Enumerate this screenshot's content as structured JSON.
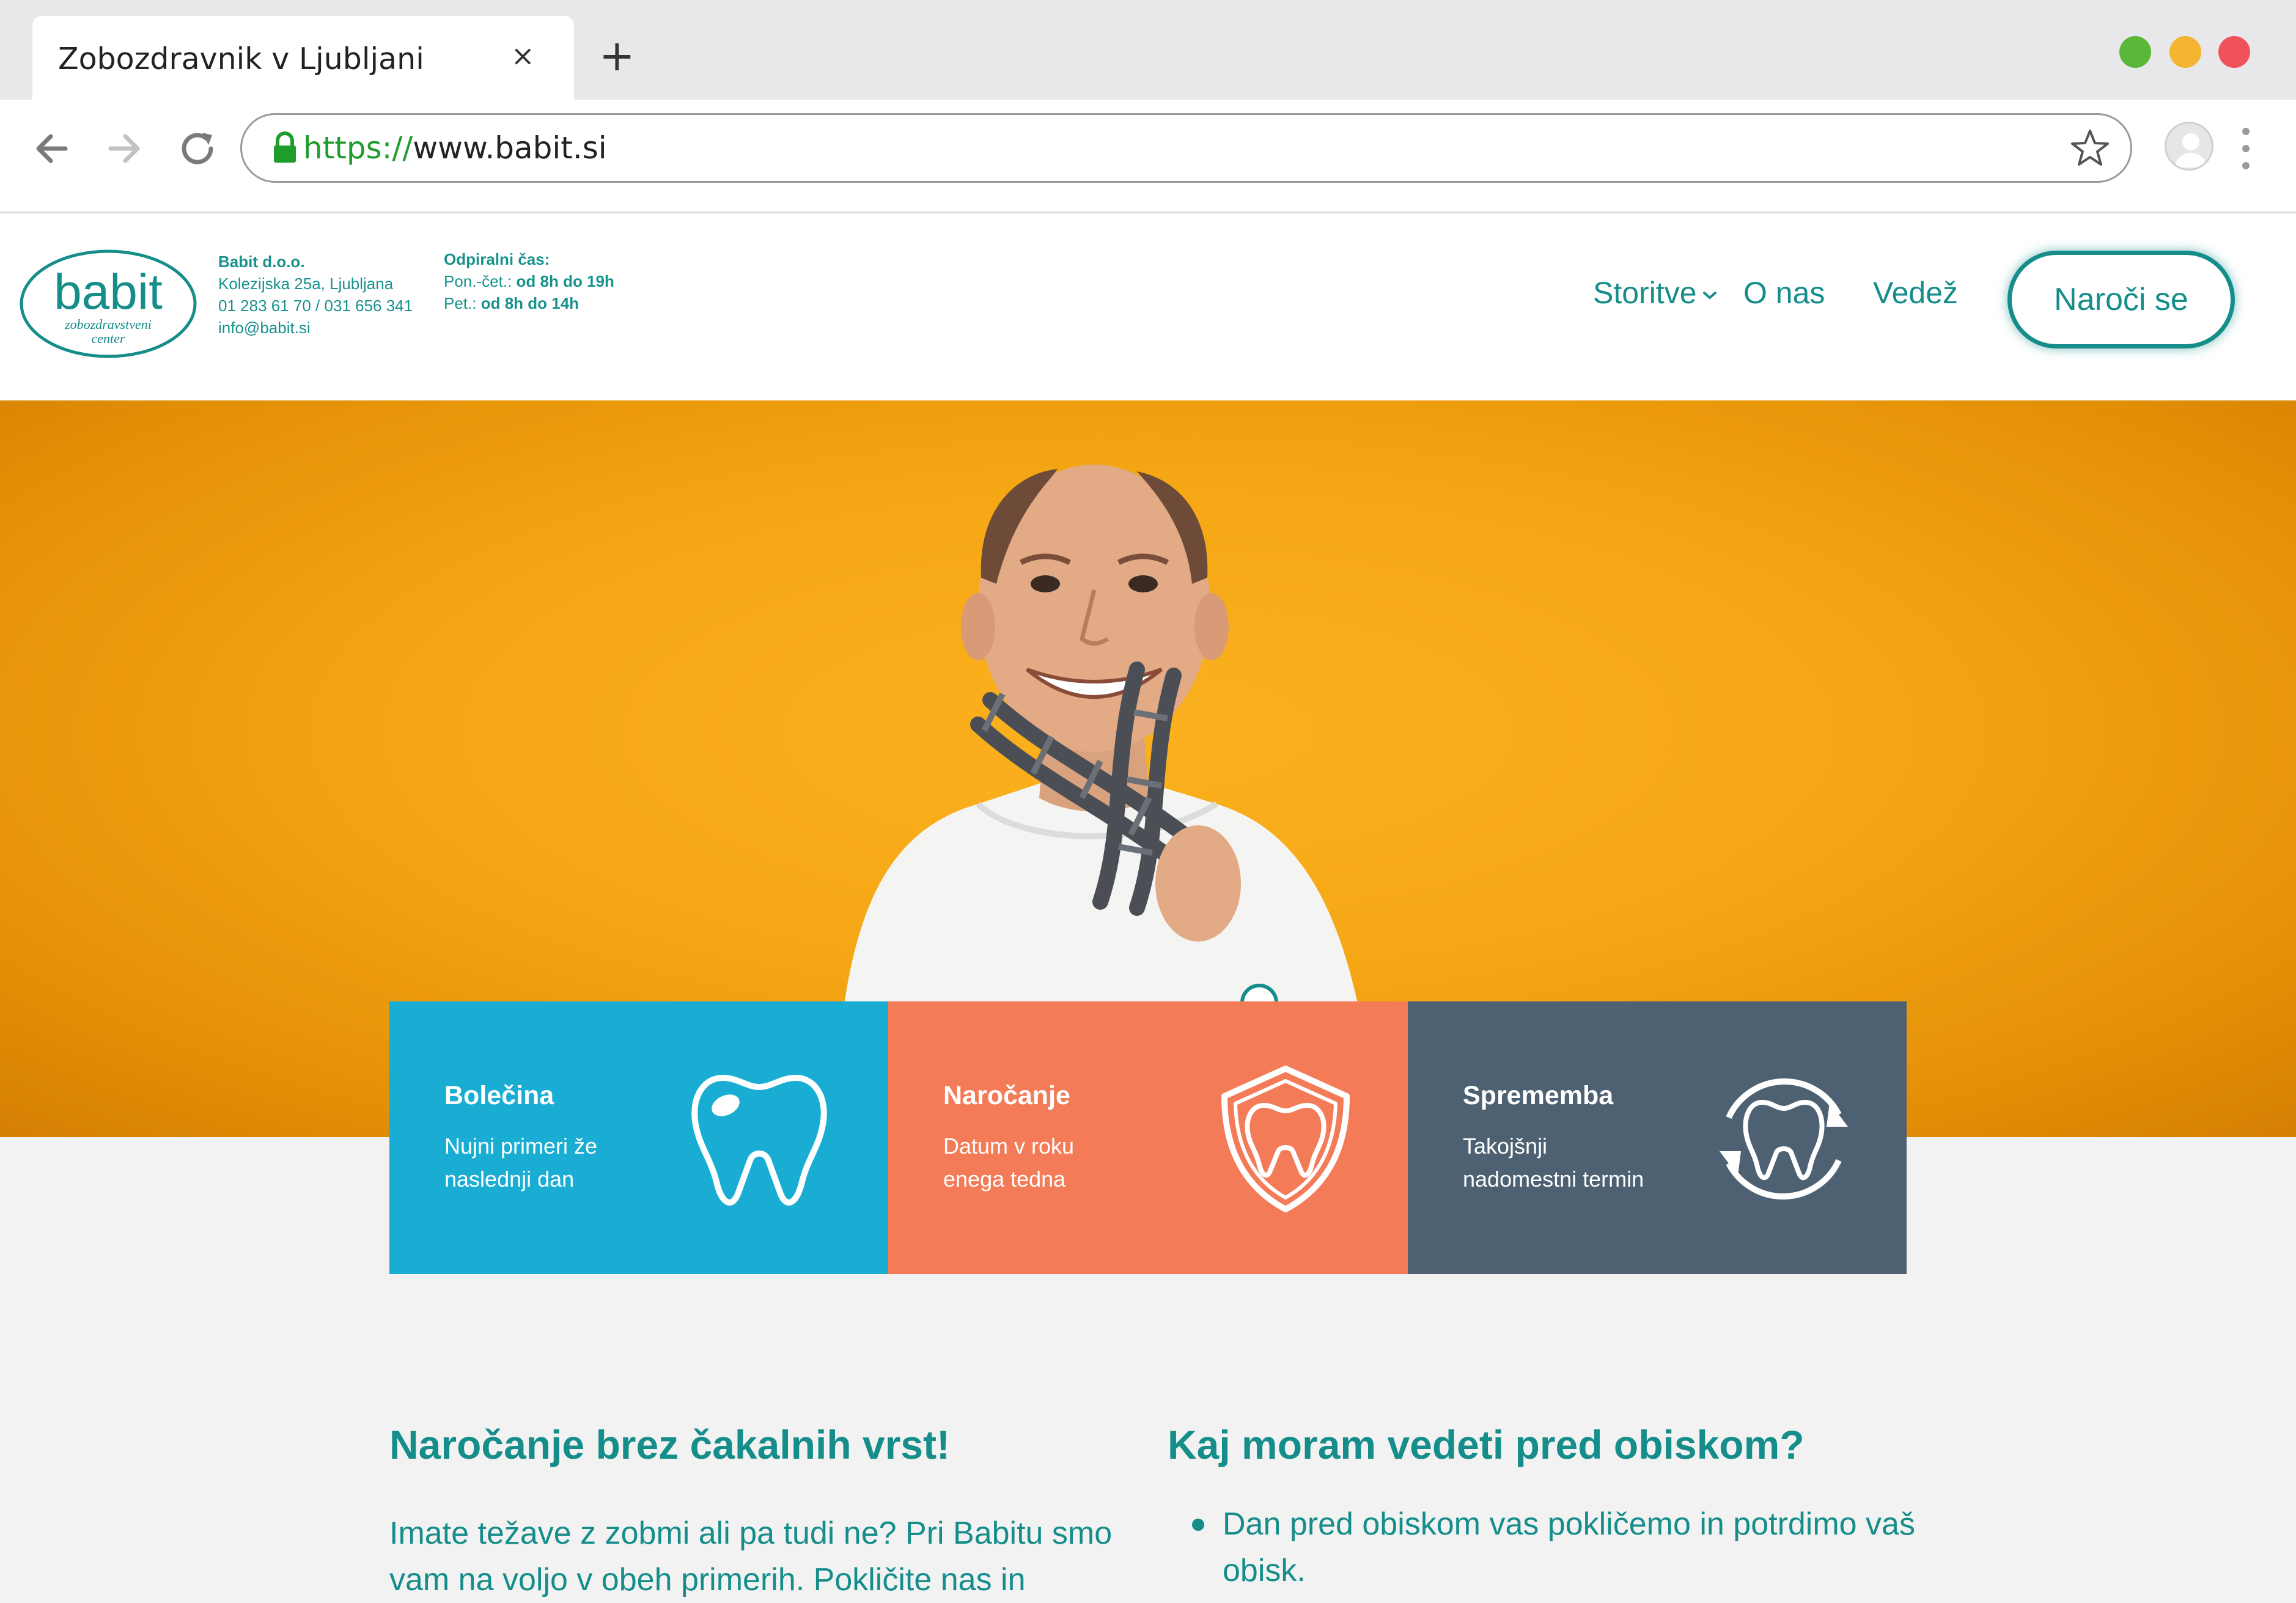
{
  "browser": {
    "tab_title": "Zobozdravnik v Ljubljani",
    "tab_close": "×",
    "new_tab": "+",
    "url_scheme": "https://",
    "url_host": "www.babit.si"
  },
  "header": {
    "logo_text": "babit",
    "logo_subtitle_1": "zobozdravstveni",
    "logo_subtitle_2": "center",
    "company_name": "Babit d.o.o.",
    "address": "Kolezijska 25a, Ljubljana",
    "phones": "01 283 61 70 / 031 656 341",
    "email": "info@babit.si",
    "hours_title": "Odpiralni čas:",
    "hours_weekday_label": "Pon.-čet.:",
    "hours_weekday_value": "od 8h do 19h",
    "hours_friday_label": "Pet.:",
    "hours_friday_value": "od 8h do 14h",
    "nav": {
      "services": "Storitve",
      "about": "O nas",
      "knowledge": "Vedež",
      "cta": "Naroči se"
    }
  },
  "cards": [
    {
      "title": "Bolečina",
      "text": "Nujni primeri že naslednji dan",
      "icon": "tooth-icon",
      "color": "#1aadd3"
    },
    {
      "title": "Naročanje",
      "text": "Datum v roku enega tedna",
      "icon": "tooth-shield-icon",
      "color": "#f37b58"
    },
    {
      "title": "Sprememba",
      "text": "Takojšnji nadomestni termin",
      "icon": "tooth-refresh-icon",
      "color": "#4d6172"
    }
  ],
  "content": {
    "left_heading": "Naročanje brez čakalnih vrst!",
    "left_paragraph": "Imate težave z zobmi ali pa tudi ne? Pri Babitu smo vam na voljo v obeh primerih. Pokličite nas in",
    "right_heading": "Kaj moram vedeti pred obiskom?",
    "right_bullet_1": "Dan pred obiskom vas pokličemo in potrdimo vaš obisk."
  },
  "colors": {
    "brand_teal": "#158d8a",
    "hero_orange": "#f5a614",
    "page_bg": "#f2f2f2"
  }
}
